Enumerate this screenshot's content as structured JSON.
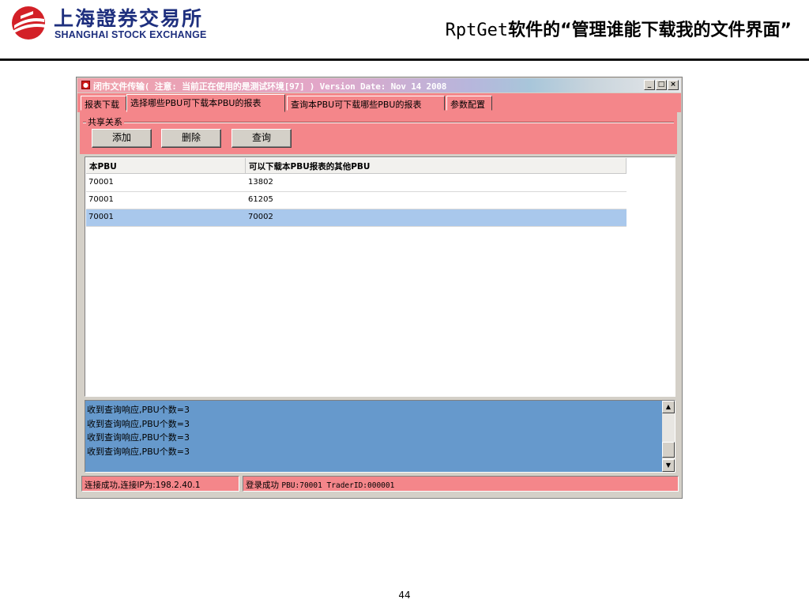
{
  "slide": {
    "logo": {
      "name_cn": "上海證券交易所",
      "name_en": "SHANGHAI STOCK EXCHANGE",
      "brand_color": "#d32027"
    },
    "title_prefix": "RptGet",
    "title_rest": "软件的“管理谁能下载我的文件界面”",
    "page_number": "44"
  },
  "window": {
    "title": "闭市文件传输( 注意: 当前正在使用的是测试环境[97] ) Version Date: Nov 14 2008",
    "controls": [
      "_",
      "□",
      "×"
    ],
    "tabs": [
      {
        "label": "报表下载",
        "active": false
      },
      {
        "label": "选择哪些PBU可下载本PBU的报表",
        "active": true
      },
      {
        "label": "查询本PBU可下载哪些PBU的报表",
        "active": false
      },
      {
        "label": "参数配置",
        "active": false
      }
    ],
    "group_title": "共享关系",
    "buttons": {
      "add": "添加",
      "delete": "删除",
      "query": "查询"
    },
    "table": {
      "columns": [
        "本PBU",
        "可以下载本PBU报表的其他PBU"
      ],
      "rows": [
        {
          "pbu": "70001",
          "other": "13802",
          "selected": false
        },
        {
          "pbu": "70001",
          "other": "61205",
          "selected": false
        },
        {
          "pbu": "70001",
          "other": "70002",
          "selected": true
        }
      ]
    },
    "log": [
      "收到查询响应,PBU个数=3",
      "收到查询响应,PBU个数=3",
      "收到查询响应,PBU个数=3",
      "收到查询响应,PBU个数=3"
    ],
    "status": {
      "connection": "连接成功,连接IP为:198.2.40.1",
      "login_prefix": "登录成功",
      "login_detail": "PBU:70001 TraderID:000001"
    },
    "colors": {
      "panel": "#f4868a",
      "log_bg": "#6699cc",
      "selected_row": "#a9c8ec"
    }
  }
}
